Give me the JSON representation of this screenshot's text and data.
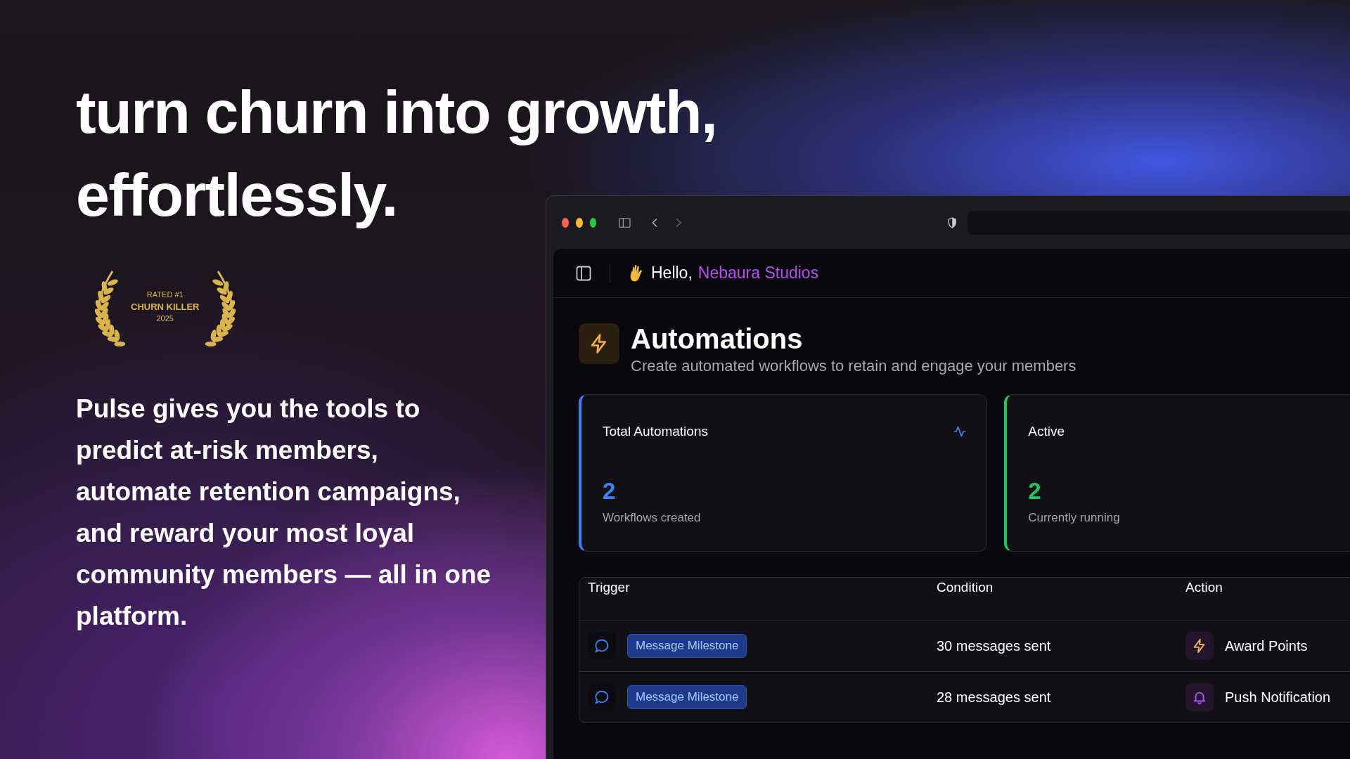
{
  "headline": [
    "turn churn into growth,",
    "effortlessly."
  ],
  "award": {
    "line1": "RATED #1",
    "line2": "CHURN KILLER",
    "line3": "2025"
  },
  "description": "Pulse gives you the tools to predict at-risk members, automate retention campaigns, and reward your most loyal community members — all in one platform.",
  "app": {
    "greeting": "Hello,",
    "user": "Nebaura Studios",
    "title": "Automations",
    "subtitle": "Create automated workflows to retain and engage your members",
    "stats": [
      {
        "title": "Total Automations",
        "value": "2",
        "caption": "Workflows created",
        "color": "#3b82f6",
        "kind": "icon"
      },
      {
        "title": "Active",
        "value": "2",
        "caption": "Currently running",
        "color": "#22c55e",
        "kind": "plain"
      }
    ],
    "table": {
      "columns": [
        "Trigger",
        "Condition",
        "Action"
      ],
      "rows": [
        {
          "trigger": "Message Milestone",
          "condition": "30 messages sent",
          "action": "Award Points",
          "kind": "points"
        },
        {
          "trigger": "Message Milestone",
          "condition": "28 messages sent",
          "action": "Push Notification",
          "kind": "notification"
        }
      ]
    }
  }
}
